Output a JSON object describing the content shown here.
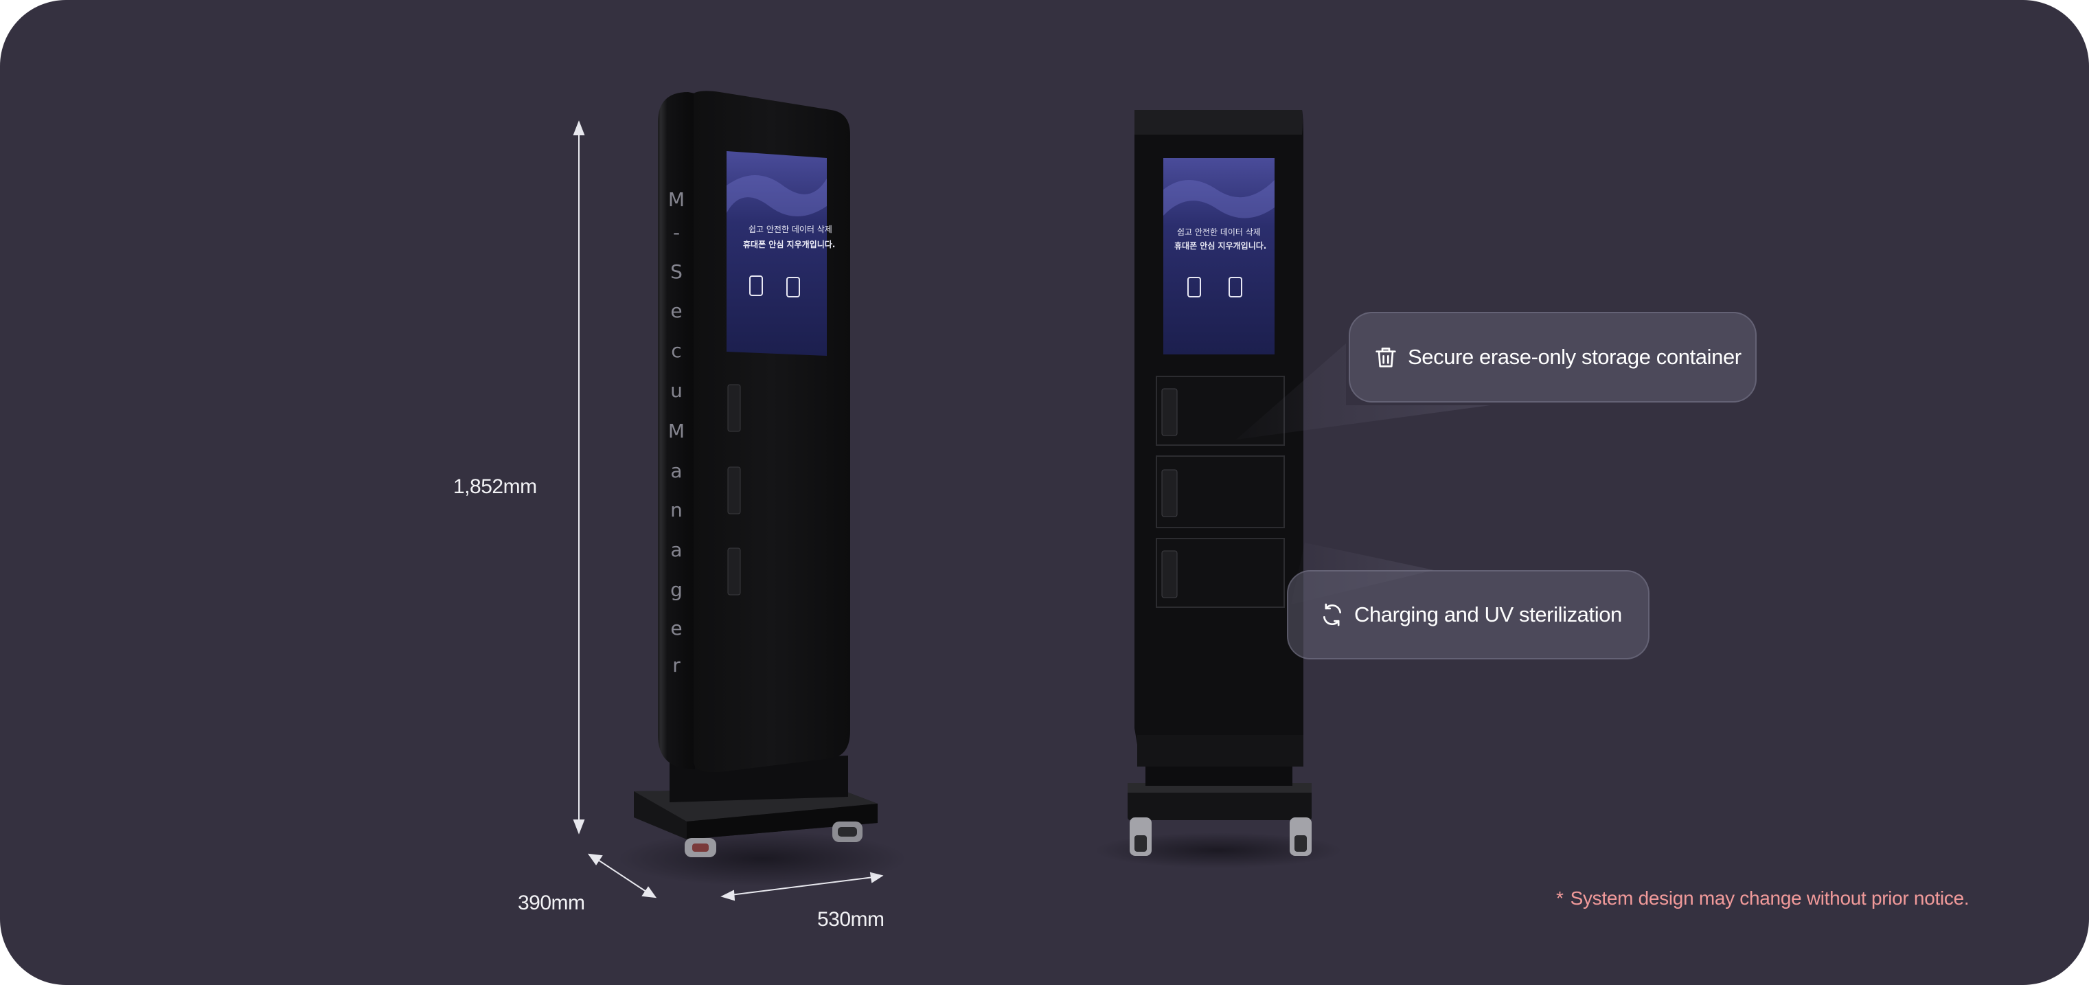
{
  "dimensions": {
    "height": "1,852mm",
    "depth": "390mm",
    "width": "530mm"
  },
  "callouts": {
    "storage": {
      "icon": "trash-icon",
      "label": "Secure erase-only storage container"
    },
    "charging": {
      "icon": "refresh-icon",
      "label": "Charging and UV sterilization"
    }
  },
  "disclaimer": {
    "marker": "*",
    "text": "System design may change without prior notice."
  },
  "kiosk": {
    "brand_vertical": "M-SecuManager",
    "screen": {
      "line1": "쉽고 안전한 데이터 삭제",
      "line2": "휴대폰 안심 지우개입니다."
    }
  },
  "colors": {
    "background": "#353140",
    "accent_disclaimer": "#f19a9a",
    "callout_fill": "#5f5c70"
  }
}
